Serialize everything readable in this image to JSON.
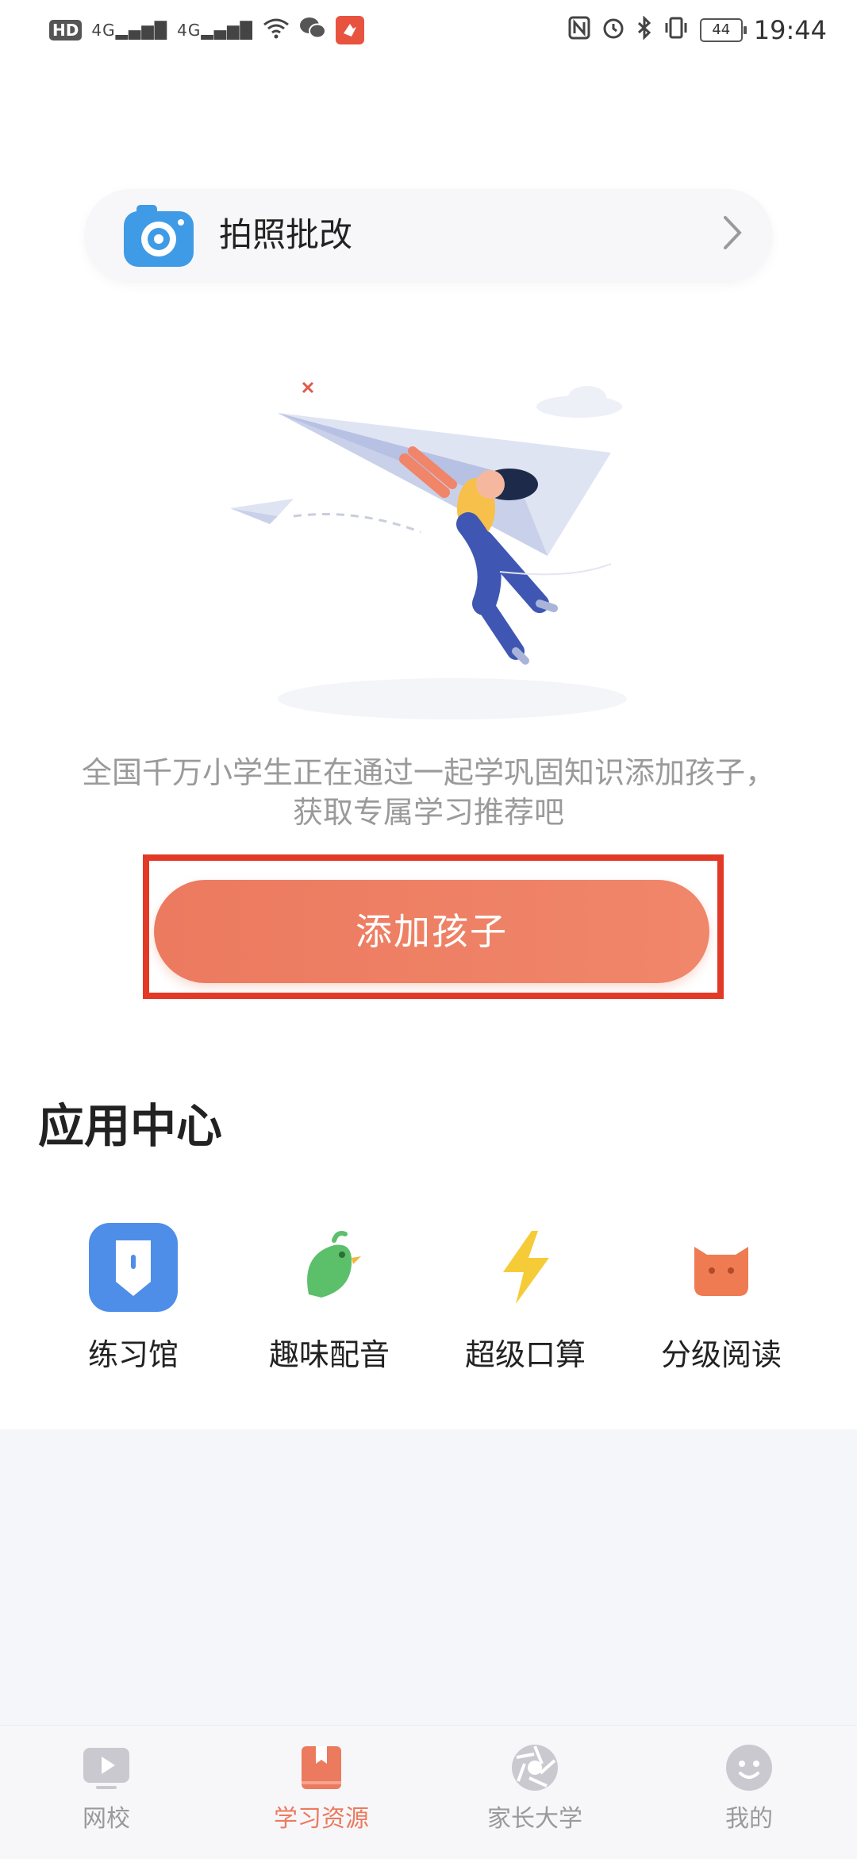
{
  "status_bar": {
    "left_indicators": [
      "HD",
      "4G",
      "4G"
    ],
    "battery": "44",
    "time": "19:44",
    "icons": [
      "wifi-icon",
      "wechat-icon",
      "app-notification-icon",
      "nfc-icon",
      "alarm-icon",
      "bluetooth-icon",
      "vibrate-icon"
    ]
  },
  "photo_card": {
    "label": "拍照批改",
    "icon": "camera-icon",
    "accent": "#3f9be6"
  },
  "promo": {
    "line1": "全国千万小学生正在通过一起学巩固知识添加孩子，",
    "line2": "获取专属学习推荐吧"
  },
  "add_child_button": {
    "label": "添加孩子",
    "color": "#ec7a5f"
  },
  "app_center": {
    "title": "应用中心",
    "apps": [
      {
        "label": "练习馆",
        "icon": "practice-hall-icon"
      },
      {
        "label": "趣味配音",
        "icon": "fun-dubbing-bird-icon"
      },
      {
        "label": "超级口算",
        "icon": "lightning-icon"
      },
      {
        "label": "分级阅读",
        "icon": "graded-reading-cat-icon"
      }
    ]
  },
  "tabs": [
    {
      "label": "网校",
      "icon": "play-icon",
      "active": false
    },
    {
      "label": "学习资源",
      "icon": "bookmark-book-icon",
      "active": true
    },
    {
      "label": "家长大学",
      "icon": "aperture-icon",
      "active": false
    },
    {
      "label": "我的",
      "icon": "smiley-icon",
      "active": false
    }
  ]
}
